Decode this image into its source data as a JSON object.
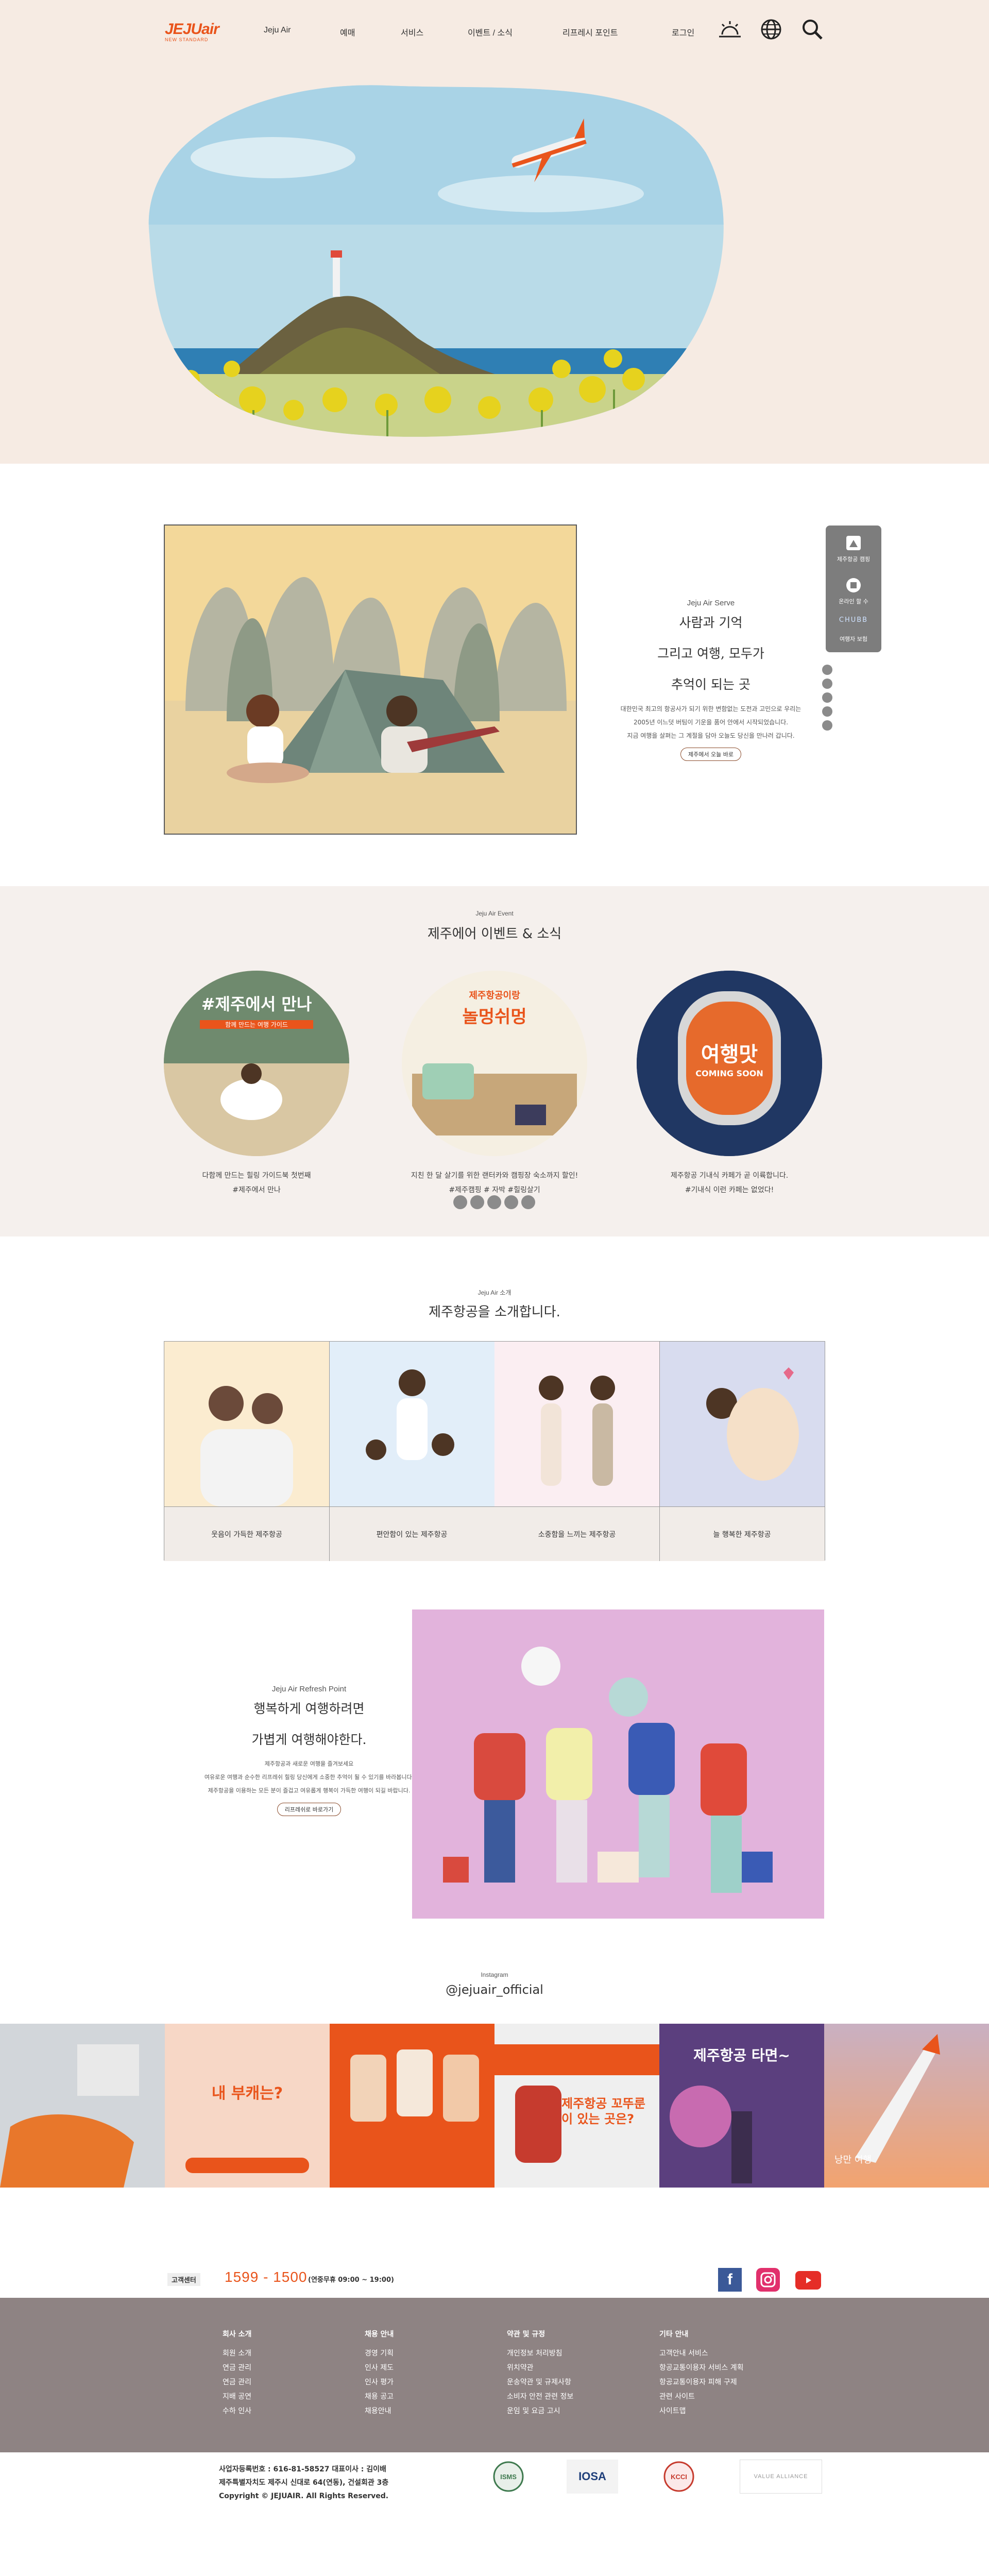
{
  "header": {
    "logo_text": "JEJUair",
    "logo_sub": "NEW STANDARD",
    "nav": [
      "Jeju Air",
      "예매",
      "서비스",
      "이벤트 / 소식",
      "리프레시 포인트",
      "로그인"
    ]
  },
  "serve": {
    "label": "Jeju Air Serve",
    "title_lines": [
      "사람과 기억",
      "그리고 여행, 모두가",
      "추억이 되는 곳"
    ],
    "desc_lines": [
      "대한민국 최고의 항공사가 되기 위한 변함없는 도전과 고민으로 우리는",
      "2005년 이느덧 버팀이 기운을 품어 안에서 시작되었습니다.",
      "지금 여행을 살펴는 그 계절을 담아 오늘도 당신을 만나러 갑니다."
    ],
    "button": "제주에서 오늘 바로",
    "quick_menu": [
      "제주항공 캠핑",
      "온라인 할 수",
      "CHUBB",
      "여행자 보험"
    ]
  },
  "event": {
    "label": "Jeju Air Event",
    "title": "제주에어 이벤트 & 소식",
    "items": [
      {
        "caption1": "다함께 만드는 힐링 가이드북 첫번째",
        "caption2": "#제주에서 만나",
        "overlay": "#제주에서 만나",
        "sub": "함께 만드는 여행 가이드"
      },
      {
        "caption1": "지친 한 달 살기를 위한 랜터카와 캠핑장 숙소까지 할인!",
        "caption2": "#제주캠핑 # 자박 #힐링살기",
        "overlay": "놀멍쉬멍",
        "sub": "제주항공이랑"
      },
      {
        "caption1": "제주항공 기내식 카페가 곧 이륙합니다.",
        "caption2": "#기내식 이런 카페는 없었다!",
        "overlay": "여행맛",
        "sub": "COMING SOON"
      }
    ]
  },
  "intro": {
    "label": "Jeju Air 소개",
    "title": "제주항공을 소개합니다.",
    "cards": [
      "웃음이 가득한 제주항공",
      "편안함이 있는 제주항공",
      "소중함을 느끼는 제주항공",
      "늘 행복한 제주항공"
    ]
  },
  "refresh": {
    "label": "Jeju Air Refresh Point",
    "title_lines": [
      "행복하게 여행하려면",
      "가볍게 여행해야한다."
    ],
    "desc_lines": [
      "제주항공과 새로운 여행을 즐겨보세요",
      "여유로운 여행과 순수한 리프레쉬 힐링 당신에게 소중한 추억이 될 수 있기를 바라봅니다.",
      "제주항공을 이용하는 모든 분이 즐겁고 여유롭게 행복이 가득한 여행이 되길 바랍니다."
    ],
    "button": "리프레쉬로 바로가기"
  },
  "insta": {
    "label": "Instagram",
    "handle": "@jejuair_official",
    "tiles": [
      "",
      "내 부캐는?",
      "",
      "제주항공 꼬뚜룬이 있는 곳은?",
      "제주항공 타면~",
      "낭만 여행"
    ]
  },
  "contact": {
    "label": "고객센터",
    "phone": "1599 - 1500",
    "hours": "(연중무휴 09:00 ~ 19:00)"
  },
  "footer": {
    "cols": [
      {
        "head": "회사 소개",
        "items": [
          "회원 소개",
          "연금 관리",
          "연금 관리",
          "지배 공연",
          "수하 인사"
        ]
      },
      {
        "head": "채용 안내",
        "items": [
          "경영 기획",
          "인사 제도",
          "인사 평가",
          "채용 공고",
          "채용안내"
        ]
      },
      {
        "head": "약관 및 규정",
        "items": [
          "개인정보 처리방침",
          "위치약관",
          "운송약관 및 규제사항",
          "소비자 안전 관련 정보",
          "운임 및 요금 고시"
        ]
      },
      {
        "head": "기타 안내",
        "items": [
          "고객안내 서비스",
          "항공교통이용자 서비스 계획",
          "항공교통이용자 피해 구제",
          "관련 사이트",
          "사이트맵"
        ]
      }
    ],
    "info_lines": [
      "사업자등록번호 : 616-81-58527   대표이사 : 김이배",
      "제주특별자치도 제주시 신대로 64(연동), 건설회관 3층",
      "Copyright © JEJUAIR. All Rights Reserved."
    ],
    "certs": [
      "ISMS",
      "IOSA",
      "KCCI",
      "VALUE ALLIANCE"
    ]
  },
  "colors": {
    "brand": "#e9541b",
    "hero_bg": "#f6ebe3",
    "footer_bg": "#8e8383"
  }
}
